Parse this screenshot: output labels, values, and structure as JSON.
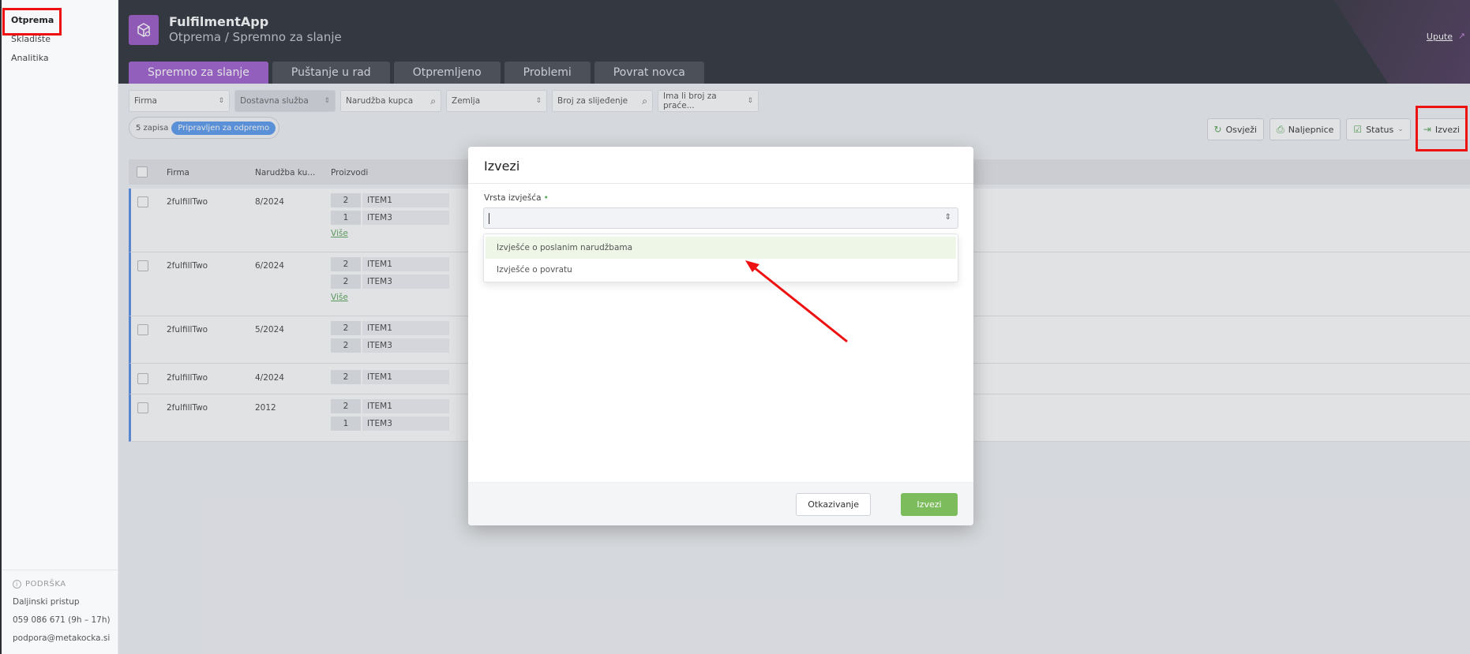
{
  "sidebar": {
    "items": [
      {
        "label": "Otprema"
      },
      {
        "label": "Skladište"
      },
      {
        "label": "Analitika"
      }
    ],
    "support": {
      "heading": "PODRŠKA",
      "remote": "Daljinski pristup",
      "phone": "059 086 671 (9h – 17h)",
      "email": "podpora@metakocka.si"
    }
  },
  "header": {
    "app_name": "FulfilmentApp",
    "breadcrumb": "Otprema / Spremno za slanje",
    "help_link": "Upute",
    "tabs": [
      {
        "label": "Spremno za slanje",
        "active": true
      },
      {
        "label": "Puštanje u rad"
      },
      {
        "label": "Otpremljeno"
      },
      {
        "label": "Problemi"
      },
      {
        "label": "Povrat novca"
      }
    ]
  },
  "filters": [
    {
      "label": "Firma"
    },
    {
      "label": "Dostavna služba"
    },
    {
      "label": "Narudžba kupca"
    },
    {
      "label": "Zemlja"
    },
    {
      "label": "Broj za slijeđenje"
    },
    {
      "label": "Ima li broj za praće..."
    }
  ],
  "summary": {
    "count": "5 zapisa",
    "status": "Pripravljen za odpremo"
  },
  "actions": {
    "refresh": "Osvježi",
    "labels": "Naljepnice",
    "status": "Status",
    "export": "Izvezi"
  },
  "table": {
    "columns": [
      "Firma",
      "Narudžba ku...",
      "Proizvodi"
    ],
    "more_link": "Više",
    "rows": [
      {
        "company": "2fulfillTwo",
        "order": "8/2024",
        "products": [
          {
            "qty": "2",
            "name": "ITEM1"
          },
          {
            "qty": "1",
            "name": "ITEM3"
          }
        ],
        "more": true
      },
      {
        "company": "2fulfillTwo",
        "order": "6/2024",
        "products": [
          {
            "qty": "2",
            "name": "ITEM1"
          },
          {
            "qty": "2",
            "name": "ITEM3"
          }
        ],
        "more": true
      },
      {
        "company": "2fulfillTwo",
        "order": "5/2024",
        "products": [
          {
            "qty": "2",
            "name": "ITEM1"
          },
          {
            "qty": "2",
            "name": "ITEM3"
          }
        ],
        "more": false
      },
      {
        "company": "2fulfillTwo",
        "order": "4/2024",
        "products": [
          {
            "qty": "2",
            "name": "ITEM1"
          }
        ],
        "more": false
      },
      {
        "company": "2fulfillTwo",
        "order": "2012",
        "products": [
          {
            "qty": "2",
            "name": "ITEM1"
          },
          {
            "qty": "1",
            "name": "ITEM3"
          }
        ],
        "more": false
      }
    ]
  },
  "modal": {
    "title": "Izvezi",
    "field_label": "Vrsta izvješća",
    "required_mark": "•",
    "input_value": "",
    "options": [
      {
        "label": "Izvješće o poslanim narudžbama",
        "highlighted": true
      },
      {
        "label": "Izvješće o povratu"
      }
    ],
    "cancel": "Otkazivanje",
    "confirm": "Izvezi"
  },
  "icons": {
    "upute_ext": "external-link-icon",
    "refresh": "refresh-icon",
    "labels": "printer-icon",
    "status": "checkbox-icon",
    "export": "export-icon"
  },
  "colors": {
    "accent_purple": "#a060d0",
    "accent_green": "#7dbc5c",
    "status_blue": "#5b9cf0",
    "row_marker": "#5b8ee6",
    "annotation_red": "#ee1111"
  }
}
